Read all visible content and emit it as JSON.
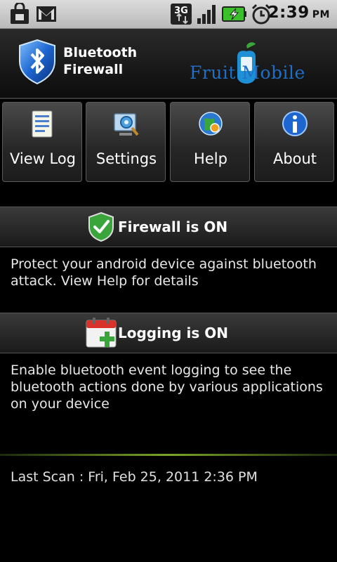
{
  "status_bar": {
    "time": "2:39",
    "ampm": "PM",
    "network": "3G",
    "icons": [
      "shopping-bag-icon",
      "gmail-icon",
      "3g-data-icon",
      "signal-strength-icon",
      "battery-charging-icon",
      "alarm-clock-icon"
    ]
  },
  "header": {
    "app_title_line1": "Bluetooth",
    "app_title_line2": "Firewall",
    "brand": "Fruit  Mobile"
  },
  "toolbar": {
    "buttons": [
      {
        "label": "View Log",
        "icon": "log-document-icon"
      },
      {
        "label": "Settings",
        "icon": "settings-icon"
      },
      {
        "label": "Help",
        "icon": "help-globe-icon"
      },
      {
        "label": "About",
        "icon": "info-icon"
      }
    ]
  },
  "firewall": {
    "status": "Firewall is ON",
    "description": "Protect your android device against bluetooth attack. View Help for details"
  },
  "logging": {
    "status": "Logging is ON",
    "description": "Enable bluetooth event logging to see the bluetooth actions done by various applications on your device"
  },
  "footer": {
    "last_scan": "Last Scan : Fri, Feb 25, 2011 2:36 PM"
  },
  "colors": {
    "brand_blue": "#1f6fc6",
    "divider_green": "#7aa52a",
    "shield_green": "#3aa53a",
    "battery_green": "#3bbf2a"
  }
}
